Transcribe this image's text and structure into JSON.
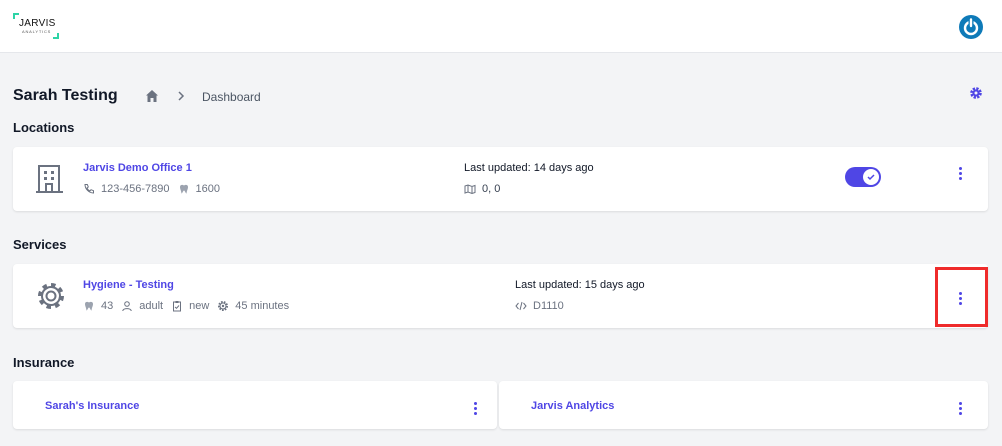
{
  "brand": {
    "name": "JARVIS",
    "sub": "ANALYTICS",
    "accent": "#2dd4a6",
    "power_color": "#0e7ab8"
  },
  "header": {
    "title": "Sarah Testing",
    "breadcrumb": [
      "Dashboard"
    ]
  },
  "colors": {
    "primary": "#4f46e5",
    "highlight": "#ef2b2b"
  },
  "sections": {
    "locations": "Locations",
    "services": "Services",
    "insurance": "Insurance"
  },
  "location": {
    "name": "Jarvis Demo Office 1",
    "phone": "123-456-7890",
    "count": "1600",
    "updated": "Last updated: 14 days ago",
    "coords": "0, 0",
    "enabled": true
  },
  "service": {
    "name": "Hygiene - Testing",
    "count": "43",
    "patient": "adult",
    "status": "new",
    "duration": "45 minutes",
    "updated": "Last updated: 15 days ago",
    "code": "D1110"
  },
  "insurance": [
    {
      "name": "Sarah's Insurance"
    },
    {
      "name": "Jarvis Analytics"
    }
  ]
}
